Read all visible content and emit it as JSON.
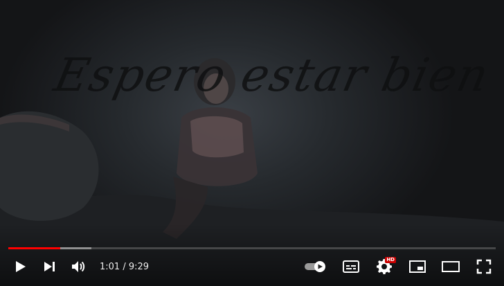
{
  "video": {
    "title_overlay": "Espero estar bien"
  },
  "progress": {
    "played_fraction": 0.107,
    "buffered_fraction": 0.17,
    "played_color": "#ff0000"
  },
  "time": {
    "display": "1:01 / 9:29"
  },
  "controls": {
    "play": "play-icon",
    "next": "next-icon",
    "volume": "volume-icon",
    "autoplay": "autoplay-toggle-icon",
    "subtitles": "subtitles-icon",
    "settings": "gear-icon",
    "settings_badge": "HD",
    "miniplayer": "miniplayer-icon",
    "theater": "theater-icon",
    "fullscreen": "fullscreen-icon"
  }
}
